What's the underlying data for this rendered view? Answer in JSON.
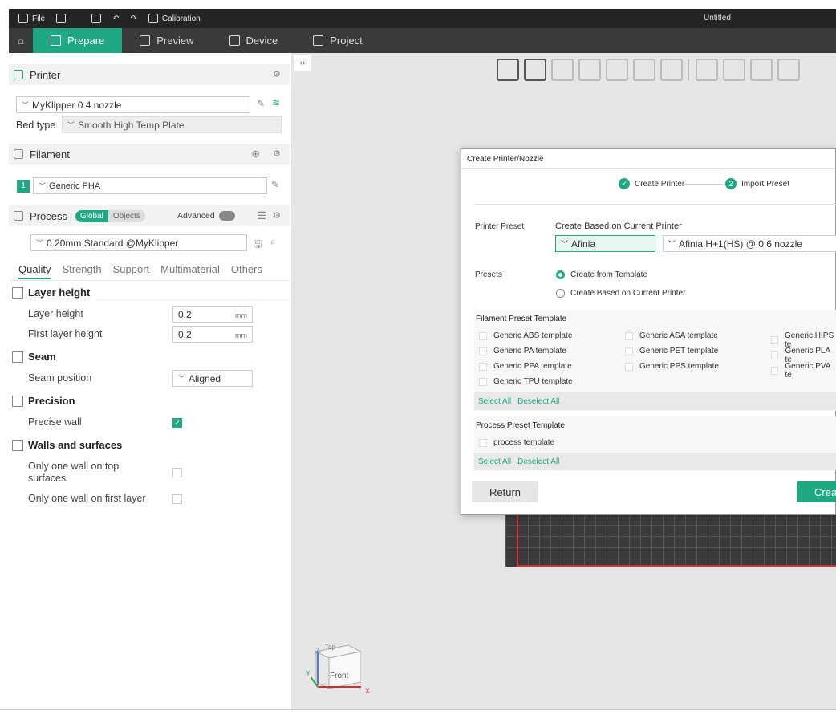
{
  "window": {
    "title": "Untitled"
  },
  "topbar": {
    "file": "File",
    "calibration": "Calibration"
  },
  "nav": {
    "tabs": [
      {
        "label": "Prepare"
      },
      {
        "label": "Preview"
      },
      {
        "label": "Device"
      },
      {
        "label": "Project"
      }
    ]
  },
  "printer": {
    "section": "Printer",
    "preset": "MyKlipper 0.4 nozzle",
    "bed_type_label": "Bed type",
    "bed_type": "Smooth High Temp Plate"
  },
  "filament": {
    "section": "Filament",
    "index": "1",
    "preset": "Generic PHA"
  },
  "process": {
    "section": "Process",
    "global": "Global",
    "objects": "Objects",
    "advanced": "Advanced",
    "preset": "0.20mm Standard @MyKlipper",
    "tabs": [
      "Quality",
      "Strength",
      "Support",
      "Multimaterial",
      "Others"
    ]
  },
  "settings": {
    "layer_height_cat": "Layer height",
    "layer_height": {
      "label": "Layer height",
      "value": "0.2",
      "unit": "mm"
    },
    "first_layer_height": {
      "label": "First layer height",
      "value": "0.2",
      "unit": "mm"
    },
    "seam_cat": "Seam",
    "seam_position": {
      "label": "Seam position",
      "value": "Aligned"
    },
    "precision_cat": "Precision",
    "precise_wall": {
      "label": "Precise wall",
      "checked": true
    },
    "walls_cat": "Walls and surfaces",
    "one_wall_top": {
      "label": "Only one wall on top surfaces",
      "checked": false
    },
    "one_wall_first": {
      "label": "Only one wall on first layer",
      "checked": false
    }
  },
  "viewcube": {
    "top": "Top",
    "front": "Front",
    "x": "X",
    "y": "Y",
    "z": "Z"
  },
  "dialog": {
    "title": "Create Printer/Nozzle",
    "steps": [
      {
        "num": "✓",
        "label": "Create Printer"
      },
      {
        "num": "2",
        "label": "Import Preset"
      }
    ],
    "printer_preset_label": "Printer Preset",
    "based_on_label": "Create Based on Current Printer",
    "vendor": "Afinia",
    "model": "Afinia H+1(HS) @ 0.6 nozzle",
    "presets_label": "Presets",
    "radio_template": "Create from Template",
    "radio_current": "Create Based on Current Printer",
    "filament_template_head": "Filament Preset Template",
    "filament_templates": [
      "Generic ABS template",
      "Generic ASA template",
      "Generic HIPS te",
      "Generic PA template",
      "Generic PET template",
      "Generic PLA te",
      "Generic PPA template",
      "Generic PPS template",
      "Generic PVA te",
      "Generic TPU template"
    ],
    "select_all": "Select All",
    "deselect_all": "Deselect All",
    "process_template_head": "Process Preset Template",
    "process_templates": [
      "process template"
    ],
    "return": "Return",
    "create": "Crea"
  }
}
